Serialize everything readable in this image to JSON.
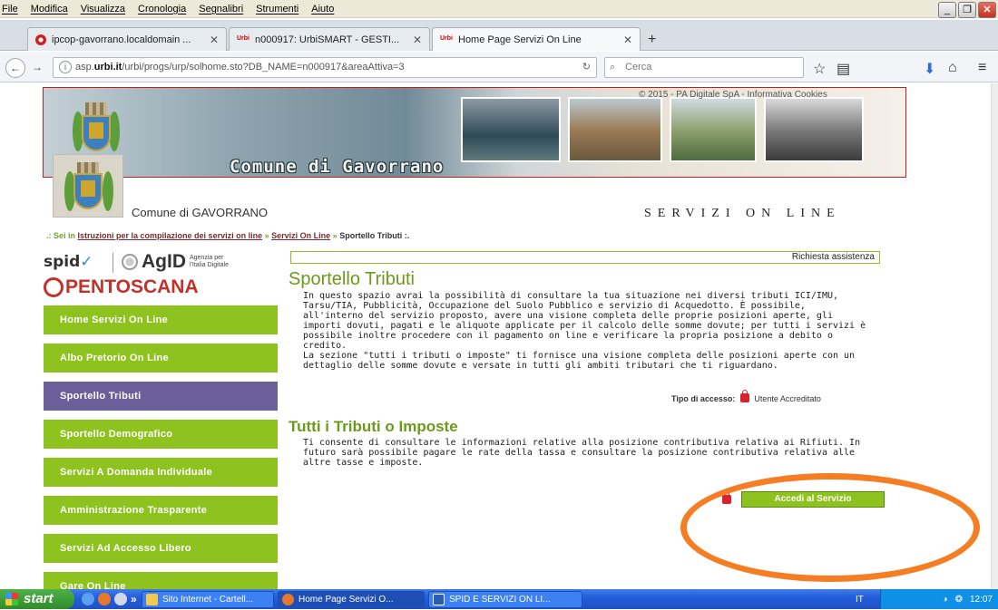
{
  "menubar": {
    "items": [
      "File",
      "Modifica",
      "Visualizza",
      "Cronologia",
      "Segnalibri",
      "Strumenti",
      "Aiuto"
    ]
  },
  "tabs": [
    {
      "label": "ipcop-gavorrano.localdomain ..."
    },
    {
      "label": "n000917: UrbiSMART - GESTI..."
    },
    {
      "label": "Home Page Servizi On Line"
    }
  ],
  "toolbar": {
    "url_prefix": "asp.",
    "url_host": "urbi.it",
    "url_path": "/urbi/progs/urp/solhome.sto?DB_NAME=n000917&areaAttiva=3",
    "search_placeholder": "Cerca"
  },
  "banner": {
    "title": "Comune di Gavorrano",
    "copyright": "© 2015 - PA Digitale SpA - Informativa Cookies"
  },
  "header": {
    "comune": "Comune di GAVORRANO",
    "servizi": "SERVIZI ON LINE"
  },
  "breadcrumb": {
    "prefix": ".: Sei in",
    "items": [
      "Istruzioni per la compilazione dei servizi on line",
      "Servizi On Line",
      "Sportello Tributi :."
    ]
  },
  "logos": {
    "spid": "spid",
    "agid": "AgID",
    "agid_sub_1": "Agenzia per",
    "agid_sub_2": "l'Italia Digitale",
    "opentoscana": "PENTOSCANA"
  },
  "sidebar": {
    "items": [
      {
        "label": "Home Servizi On Line"
      },
      {
        "label": "Albo Pretorio On Line"
      },
      {
        "label": "Sportello Tributi"
      },
      {
        "label": "Sportello Demografico"
      },
      {
        "label": "Servizi A Domanda Individuale"
      },
      {
        "label": "Amministrazione Trasparente"
      },
      {
        "label": "Servizi Ad Accesso Libero"
      },
      {
        "label": "Gare On Line"
      }
    ]
  },
  "main": {
    "assistenza": "Richiesta assistenza",
    "section_title": "Sportello Tributi",
    "section_desc_1": "In questo spazio avrai la possibilità di consultare la tua situazione nei diversi tributi ICI/IMU, Tarsu/TIA, Pubblicità, Occupazione del Suolo Pubblico e servizio di Acquedotto. È possibile, all'interno del servizio proposto, avere una visione completa delle proprie posizioni aperte, gli importi dovuti, pagati e le aliquote applicate per il calcolo delle somme dovute; per tutti i servizi è possibile inoltre procedere con il pagamento on line e verificare la propria posizione a debito o credito.",
    "section_desc_2": "La sezione \"tutti i tributi o imposte\" ti fornisce una visione completa delle posizioni aperte con un dettaglio delle somme dovute e versate in tutti gli ambiti tributari che ti riguardano.",
    "access_label": "Tipo di accesso:",
    "access_value": "Utente Accreditato",
    "sub_title": "Tutti i Tributi o Imposte",
    "sub_desc": "Ti consente di consultare le informazioni relative alla posizione contributiva relativa ai Rifiuti. In futuro sarà possibile pagare le rate della tassa e consultare la posizione contributiva relativa alle altre tasse e imposte.",
    "accedi": "Accedi al Servizio"
  },
  "taskbar": {
    "start": "start",
    "tasks": [
      {
        "label": "Sito Internet - Cartell..."
      },
      {
        "label": "Home Page Servizi O..."
      },
      {
        "label": "SPID E SERVIZI ON LI..."
      }
    ],
    "lang": "IT",
    "clock": "12:07"
  }
}
